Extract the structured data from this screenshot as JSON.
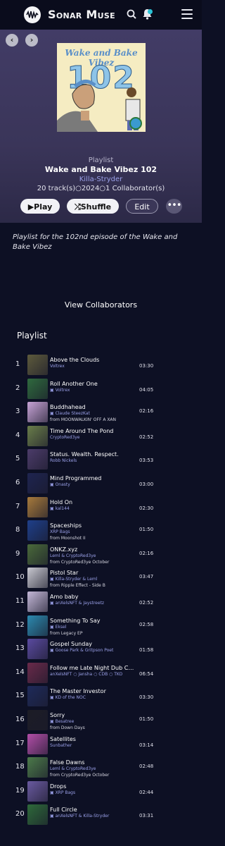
{
  "header": {
    "brand": "Sonar Muse",
    "icons": [
      "logo-icon",
      "search-icon",
      "bell-icon",
      "menu-icon"
    ]
  },
  "nav": {
    "back": "‹",
    "forward": "›"
  },
  "cover": {
    "title": "Wake and Bake Vibez",
    "number": "102"
  },
  "playlist": {
    "label": "Playlist",
    "name": "Wake and Bake Vibez 102",
    "owner": "Killa-Stryder",
    "meta": "20 track(s)○2024○1 Collaborator(s)",
    "description": "Playlist for the 102nd episode of the Wake and Bake Vibez"
  },
  "actions": {
    "play": "▶Play",
    "shuffle": "⤮Shuffle",
    "edit": "Edit",
    "more": "•••"
  },
  "view_collaborators": "View Collaborators",
  "section_title": "Playlist",
  "tracks": [
    {
      "num": "1",
      "title": "Above the Clouds",
      "artist": "Voltrex",
      "from": "",
      "duration": "03:30",
      "color": "#5d5a3c"
    },
    {
      "num": "2",
      "title": "Roll Another One",
      "artist": "▣ Voltrex",
      "from": "",
      "duration": "04:05",
      "color": "#2f6a3e"
    },
    {
      "num": "3",
      "title": "Buddhahead",
      "artist": "▣ Claude SteezKat",
      "from": "from MOONWALKIN' OFF A XAN",
      "duration": "02:16",
      "color": "#c7a3d6"
    },
    {
      "num": "4",
      "title": "Time Around The Pond",
      "artist": "CryptoRed3ye",
      "from": "",
      "duration": "02:52",
      "color": "#6a7d4a"
    },
    {
      "num": "5",
      "title": "Status. Wealth. Respect.",
      "artist": "Robb Nickels",
      "from": "",
      "duration": "03:53",
      "color": "#4c3c6a"
    },
    {
      "num": "6",
      "title": "Mind Programmed",
      "artist": "▣ Onasty",
      "from": "",
      "duration": "03:00",
      "color": "#1e2450"
    },
    {
      "num": "7",
      "title": "Hold On",
      "artist": "▣ kal144",
      "from": "",
      "duration": "02:30",
      "color": "#a77a3c"
    },
    {
      "num": "8",
      "title": "Spaceships",
      "artist": "XRP Bags",
      "from": "from Moonshot II",
      "duration": "01:50",
      "color": "#1e3f8a"
    },
    {
      "num": "9",
      "title": "ONKZ.xyz",
      "artist": "Leml & CryptoRed3ye",
      "from": "from CryptoRed3ye October",
      "duration": "02:16",
      "color": "#4a6a3a"
    },
    {
      "num": "10",
      "title": "Pistol Star",
      "artist": "▣ Killa-Stryder & Leml",
      "from": "from Ripple Effect - Side B",
      "duration": "03:47",
      "color": "#c8c8d0"
    },
    {
      "num": "11",
      "title": "Amo baby",
      "artist": "▣ anXelsNFT & Jaystreetz",
      "from": "",
      "duration": "02:52",
      "color": "#c4b8d8"
    },
    {
      "num": "12",
      "title": "Something To Say",
      "artist": "▣ Eksel",
      "from": "from Legacy EP",
      "duration": "02:58",
      "color": "#2c8ab0"
    },
    {
      "num": "13",
      "title": "Gospel Sunday",
      "artist": "▣ Goose Park & Gritpson Poet",
      "from": "",
      "duration": "01:58",
      "color": "#5a4aa0"
    },
    {
      "num": "14",
      "title": "Follow me Late Night Dub CDB r…",
      "artist": "anXelsNFT ○ Jansha ○ CDB ○ TKO",
      "from": "",
      "duration": "06:54",
      "color": "#6a2a4a"
    },
    {
      "num": "15",
      "title": "The Master Investor",
      "artist": "▣ KD of the NOC",
      "from": "",
      "duration": "03:30",
      "color": "#1e2a5a"
    },
    {
      "num": "16",
      "title": "Sorry",
      "artist": "▣ Besatree",
      "from": "from Down Days",
      "duration": "01:50",
      "color": "#1c1c26"
    },
    {
      "num": "17",
      "title": "Satellites",
      "artist": "Sunbather",
      "from": "",
      "duration": "03:14",
      "color": "#b24ea8"
    },
    {
      "num": "18",
      "title": "False Dawns",
      "artist": "Leml & CryptoRed3ye",
      "from": "from CryptoRed3ye October",
      "duration": "02:48",
      "color": "#4c7a4a"
    },
    {
      "num": "19",
      "title": "Drops",
      "artist": "▣ XRP Bags",
      "from": "",
      "duration": "02:44",
      "color": "#6a5aa0"
    },
    {
      "num": "20",
      "title": "Full Circle",
      "artist": "▣ anXelsNFT & Killa-Stryder",
      "from": "",
      "duration": "03:31",
      "color": "#2e6a3a"
    }
  ]
}
